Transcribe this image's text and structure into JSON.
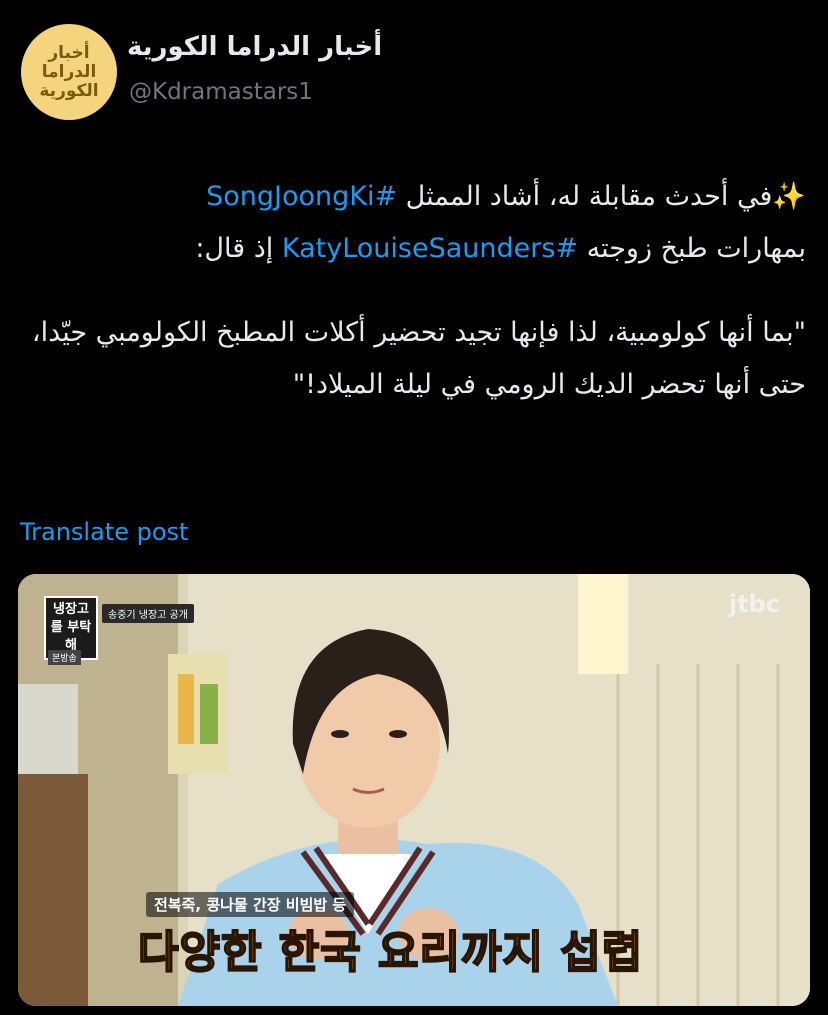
{
  "account": {
    "avatar_text": "أخبار الدراما الكورية",
    "display_name": "أخبار الدراما الكورية",
    "handle": "@Kdramastars1"
  },
  "post": {
    "line1_pre": "✨في أحدث مقابلة له، أشاد الممثل ",
    "hashtag1": "#SongJoongKi",
    "line2_pre": "بمهارات طبخ زوجته ",
    "hashtag2": "#KatyLouiseSaunders",
    "line2_post": " إذ قال:",
    "quote": "\"بما أنها كولومبية، لذا فإنها تجيد تحضير أكلات المطبخ الكولومبي جيّدا، حتى أنها تحضر الديك الرومي في ليلة الميلاد!\""
  },
  "translate_label": "Translate post",
  "media": {
    "broadcaster": "jtbc",
    "show_logo": "냉장고를 부탁해",
    "show_tag": "송중기 냉장고 공개",
    "replay_tag": "본방송",
    "caption_small": "전복죽, 콩나물 간장 비빔밥 등",
    "caption_big": "다양한 한국 요리까지 섭렵"
  },
  "colors": {
    "background": "#000000",
    "text": "#e7e9ea",
    "muted": "#71767b",
    "link": "#1d9bf0",
    "avatar_bg": "#f4d47c"
  }
}
